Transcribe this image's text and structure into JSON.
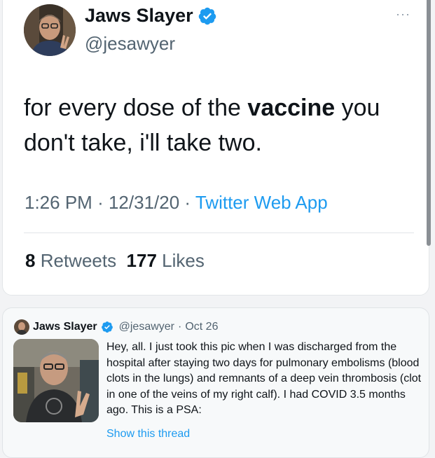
{
  "main_tweet": {
    "display_name": "Jaws Slayer",
    "handle": "@jesawyer",
    "more_label": "···",
    "text_before": "for every dose of the ",
    "text_bold": "vaccine",
    "text_after": " you don't take, i'll take two.",
    "time": "1:26 PM",
    "separator": "·",
    "date": "12/31/20",
    "source": "Twitter Web App",
    "retweets_count": "8",
    "retweets_label": "Retweets",
    "likes_count": "177",
    "likes_label": "Likes"
  },
  "quoted_tweet": {
    "display_name": "Jaws Slayer",
    "handle": "@jesawyer",
    "separator": "·",
    "date": "Oct 26",
    "text": "Hey, all. I just took this pic when I was discharged from the hospital after staying two days for pulmonary embolisms (blood clots in the lungs) and remnants of a deep vein thrombosis (clot in one of the veins of my right calf). I had COVID 3.5 months ago. This is a PSA:",
    "show_thread": "Show this thread"
  },
  "colors": {
    "accent": "#1d9bf0",
    "secondary_text": "#536471",
    "primary_text": "#0f1419"
  },
  "icons": {
    "verified": "verified-badge-icon",
    "more": "more-icon"
  }
}
